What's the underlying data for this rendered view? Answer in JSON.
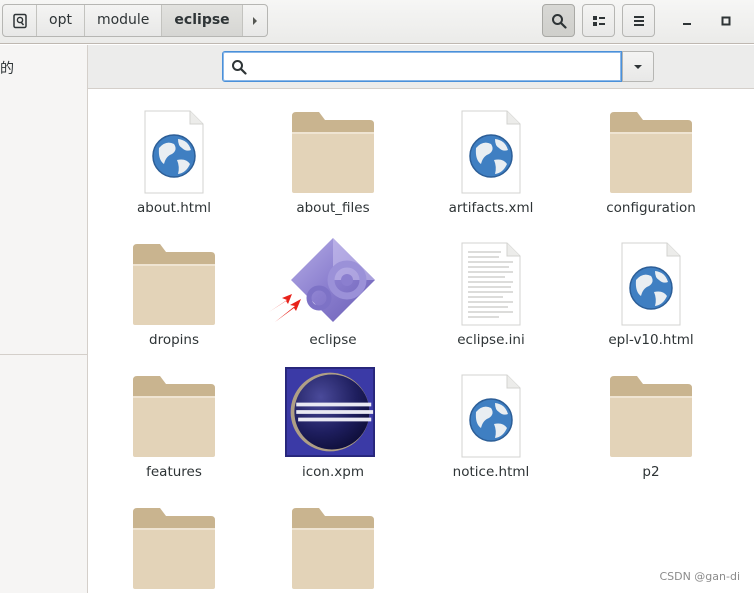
{
  "pathbar": {
    "crumbs": [
      "opt",
      "module",
      "eclipse"
    ]
  },
  "sidebar": {
    "partial_text": "的"
  },
  "search": {
    "value": "",
    "placeholder": ""
  },
  "files": [
    {
      "name": "about.html",
      "type": "html"
    },
    {
      "name": "about_files",
      "type": "folder"
    },
    {
      "name": "artifacts.xml",
      "type": "xml"
    },
    {
      "name": "configuration",
      "type": "folder"
    },
    {
      "name": "dropins",
      "type": "folder"
    },
    {
      "name": "eclipse",
      "type": "executable"
    },
    {
      "name": "eclipse.ini",
      "type": "text"
    },
    {
      "name": "epl-v10.html",
      "type": "html"
    },
    {
      "name": "features",
      "type": "folder"
    },
    {
      "name": "icon.xpm",
      "type": "image"
    },
    {
      "name": "notice.html",
      "type": "html"
    },
    {
      "name": "p2",
      "type": "folder"
    },
    {
      "name": "",
      "type": "folder"
    },
    {
      "name": "",
      "type": "folder"
    }
  ],
  "watermark": "CSDN @gan-di",
  "colors": {
    "accent": "#4a90d9",
    "folder": "#e3d3b8",
    "folder_tab": "#c9b48f",
    "arrow_annotation": "#e8221a"
  }
}
